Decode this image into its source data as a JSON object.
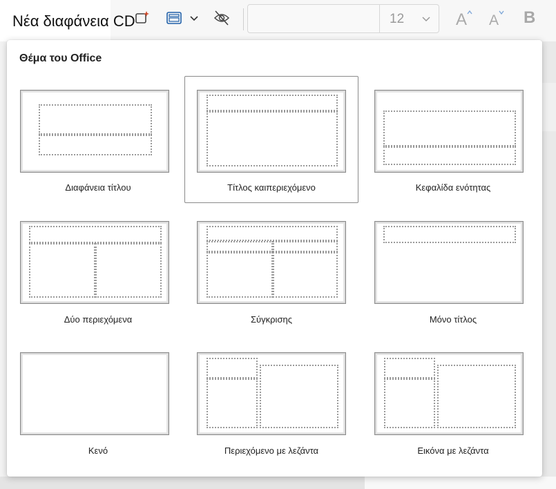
{
  "ribbon": {
    "title": "Νέα διαφάνεια CD",
    "font_size_value": "12",
    "grow_font_label": "A^",
    "shrink_font_label": "Aˇ",
    "bold_label": "B",
    "icons": [
      "designer-sparkle-icon",
      "layout-icon",
      "chevron-down-icon",
      "hide-slide-icon"
    ]
  },
  "gallery": {
    "heading": "Θέμα του Office",
    "selected_index": 1,
    "layouts": [
      {
        "label": "Διαφάνεια τίτλου"
      },
      {
        "label": "Τίτλος καιπεριεχόμενο"
      },
      {
        "label": "Κεφαλίδα ενότητας"
      },
      {
        "label": "Δύο περιεχόμενα"
      },
      {
        "label": "Σύγκρισης"
      },
      {
        "label": "Μόνο τίτλος"
      },
      {
        "label": "Κενό"
      },
      {
        "label": "Περιεχόμενο με λεζάντα"
      },
      {
        "label": "Εικόνα με λεζάντα"
      }
    ]
  },
  "colors": {
    "panel_bg": "#ffffff",
    "selected_border": "#8a8a8a",
    "placeholder_dots": "#9a9a9a"
  }
}
